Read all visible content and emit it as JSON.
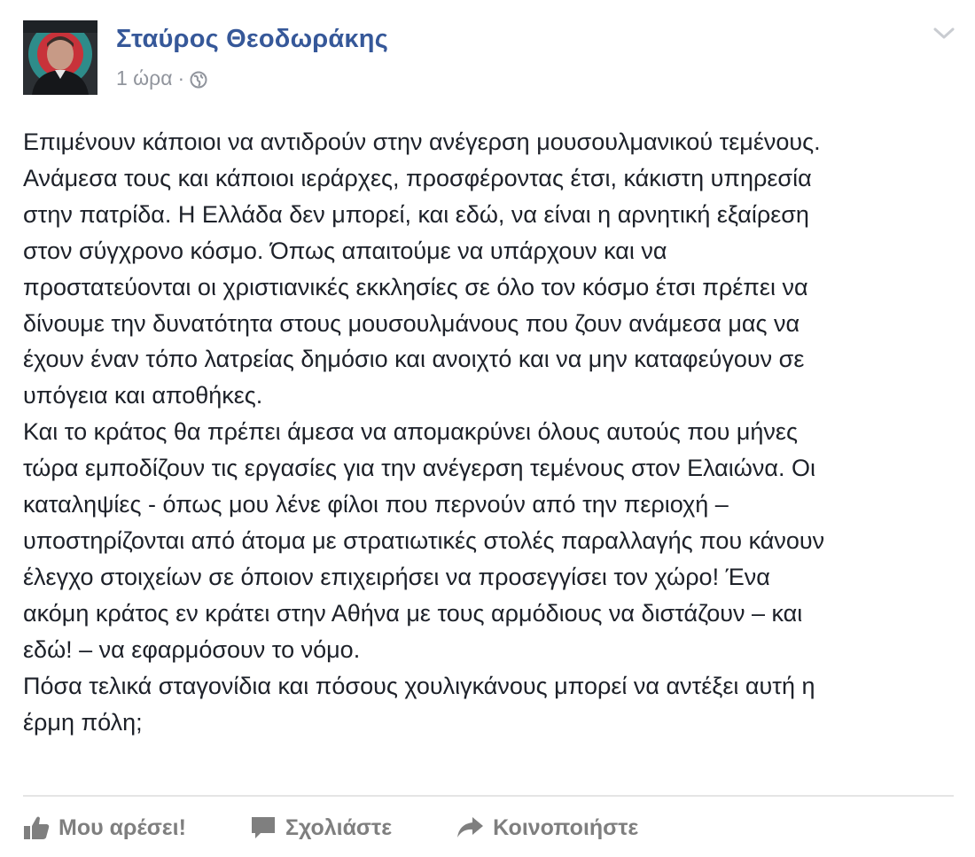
{
  "post": {
    "author": "Σταύρος Θεοδωράκης",
    "time": "1 ώρα",
    "separator": "·",
    "icons": {
      "privacy": "globe-icon",
      "menu": "chevron-down-icon"
    },
    "lines": [
      "Επιμένουν κάποιοι να αντιδρούν στην ανέγερση μουσουλμανικού τεμένους.",
      "Ανάμεσα τους και κάποιοι ιεράρχες, προσφέροντας έτσι, κάκιστη υπηρεσία",
      "στην πατρίδα. Η Ελλάδα δεν μπορεί, και εδώ, να είναι η αρνητική εξαίρεση",
      "στον σύγχρονο κόσμο. Όπως απαιτούμε να υπάρχουν και να",
      "προστατεύονται οι χριστιανικές εκκλησίες σε όλο τον κόσμο έτσι πρέπει να",
      "δίνουμε την δυνατότητα στους μουσουλμάνους που ζουν ανάμεσα μας να",
      "έχουν έναν τόπο λατρείας δημόσιο και ανοιχτό και να μην καταφεύγουν σε",
      "υπόγεια και αποθήκες.",
      "Και το κράτος θα πρέπει άμεσα να απομακρύνει όλους αυτούς που μήνες",
      "τώρα εμποδίζουν τις εργασίες για την ανέγερση τεμένους στον Ελαιώνα. Οι",
      "καταληψίες - όπως μου λένε φίλοι που περνούν από την περιοχή –",
      "υποστηρίζονται από άτομα με στρατιωτικές στολές παραλλαγής που κάνουν",
      "έλεγχο στοιχείων σε όποιον επιχειρήσει να προσεγγίσει τον χώρο! Ένα",
      "ακόμη κράτος εν κράτει στην Αθήνα με τους αρμόδιους να διστάζουν – και",
      "εδώ! – να εφαρμόσουν το νόμο.",
      "Πόσα τελικά σταγονίδια και πόσους χουλιγκάνους μπορεί να αντέξει αυτή η",
      "έρμη πόλη;"
    ]
  },
  "actions": {
    "like": {
      "label": "Μου αρέσει!",
      "icon": "thumbs-up-icon"
    },
    "comment": {
      "label": "Σχολιάστε",
      "icon": "comment-icon"
    },
    "share": {
      "label": "Κοινοποιήστε",
      "icon": "share-arrow-icon"
    }
  },
  "colors": {
    "author": "#365899",
    "meta": "#90949c",
    "text": "#1d2129",
    "action": "#7f7f7f",
    "divider": "#e5e5e5"
  }
}
